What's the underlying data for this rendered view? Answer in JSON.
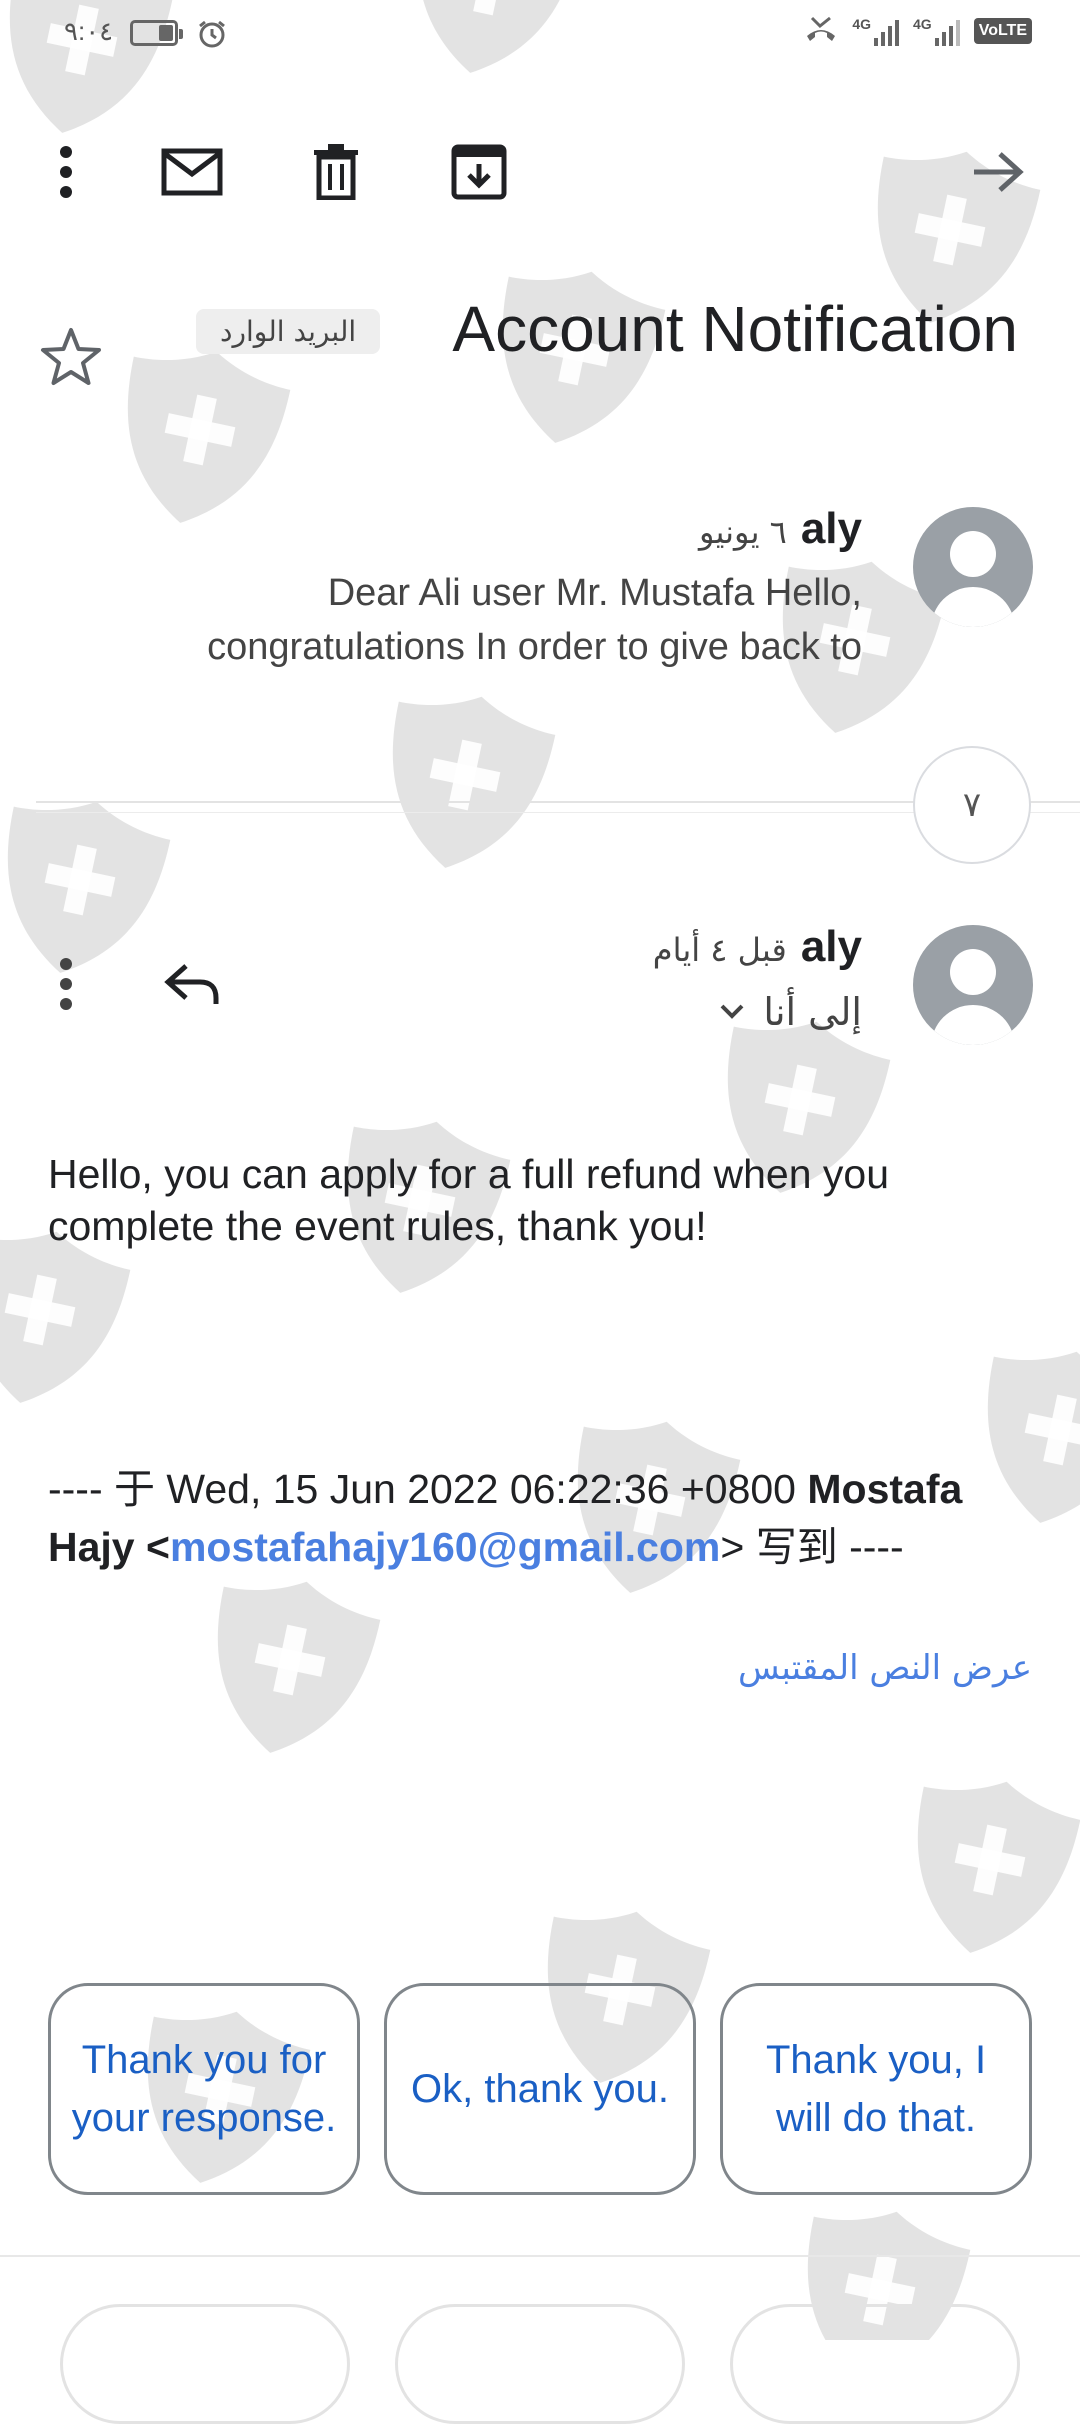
{
  "status_bar": {
    "time": "٩:٠٤",
    "network_a": "4G",
    "network_b": "4G",
    "volte": "VoLTE"
  },
  "toolbar": {
    "icons": [
      "more-vert-icon",
      "mail-icon",
      "delete-icon",
      "archive-icon",
      "forward-arrow-icon"
    ]
  },
  "subject": {
    "title": "Account Notification",
    "label": "البريد الوارد"
  },
  "messages": [
    {
      "sender": "aly",
      "date": "٦ يونيو",
      "snippet_line1": "Dear Ali user Mr. Mustafa Hello,",
      "snippet_line2": "congratulations In order to give back to"
    },
    {
      "sender": "aly",
      "date": "قبل ٤ أيام",
      "recipient": "إلى أنا",
      "body": "Hello, you can apply for a full refund when you complete the event rules, thank you!",
      "quote_prefix": "---- 于 Wed, 15 Jun 2022 06:22:36 +0800 ",
      "quote_name": "Mostafa Hajy",
      "quote_lt": " <",
      "quote_email": "mostafahajy160@gmail.com",
      "quote_suffix": "> 写到 ----",
      "show_quoted": "عرض النص المقتبس"
    }
  ],
  "collapsed_count": "٧",
  "smart_replies": [
    "Thank you for your response.",
    "Ok, thank you.",
    "Thank you, I will do that."
  ],
  "colors": {
    "link": "#4a7fe0",
    "chip_text": "#1a5fc4",
    "avatar": "#9aa0a6"
  }
}
